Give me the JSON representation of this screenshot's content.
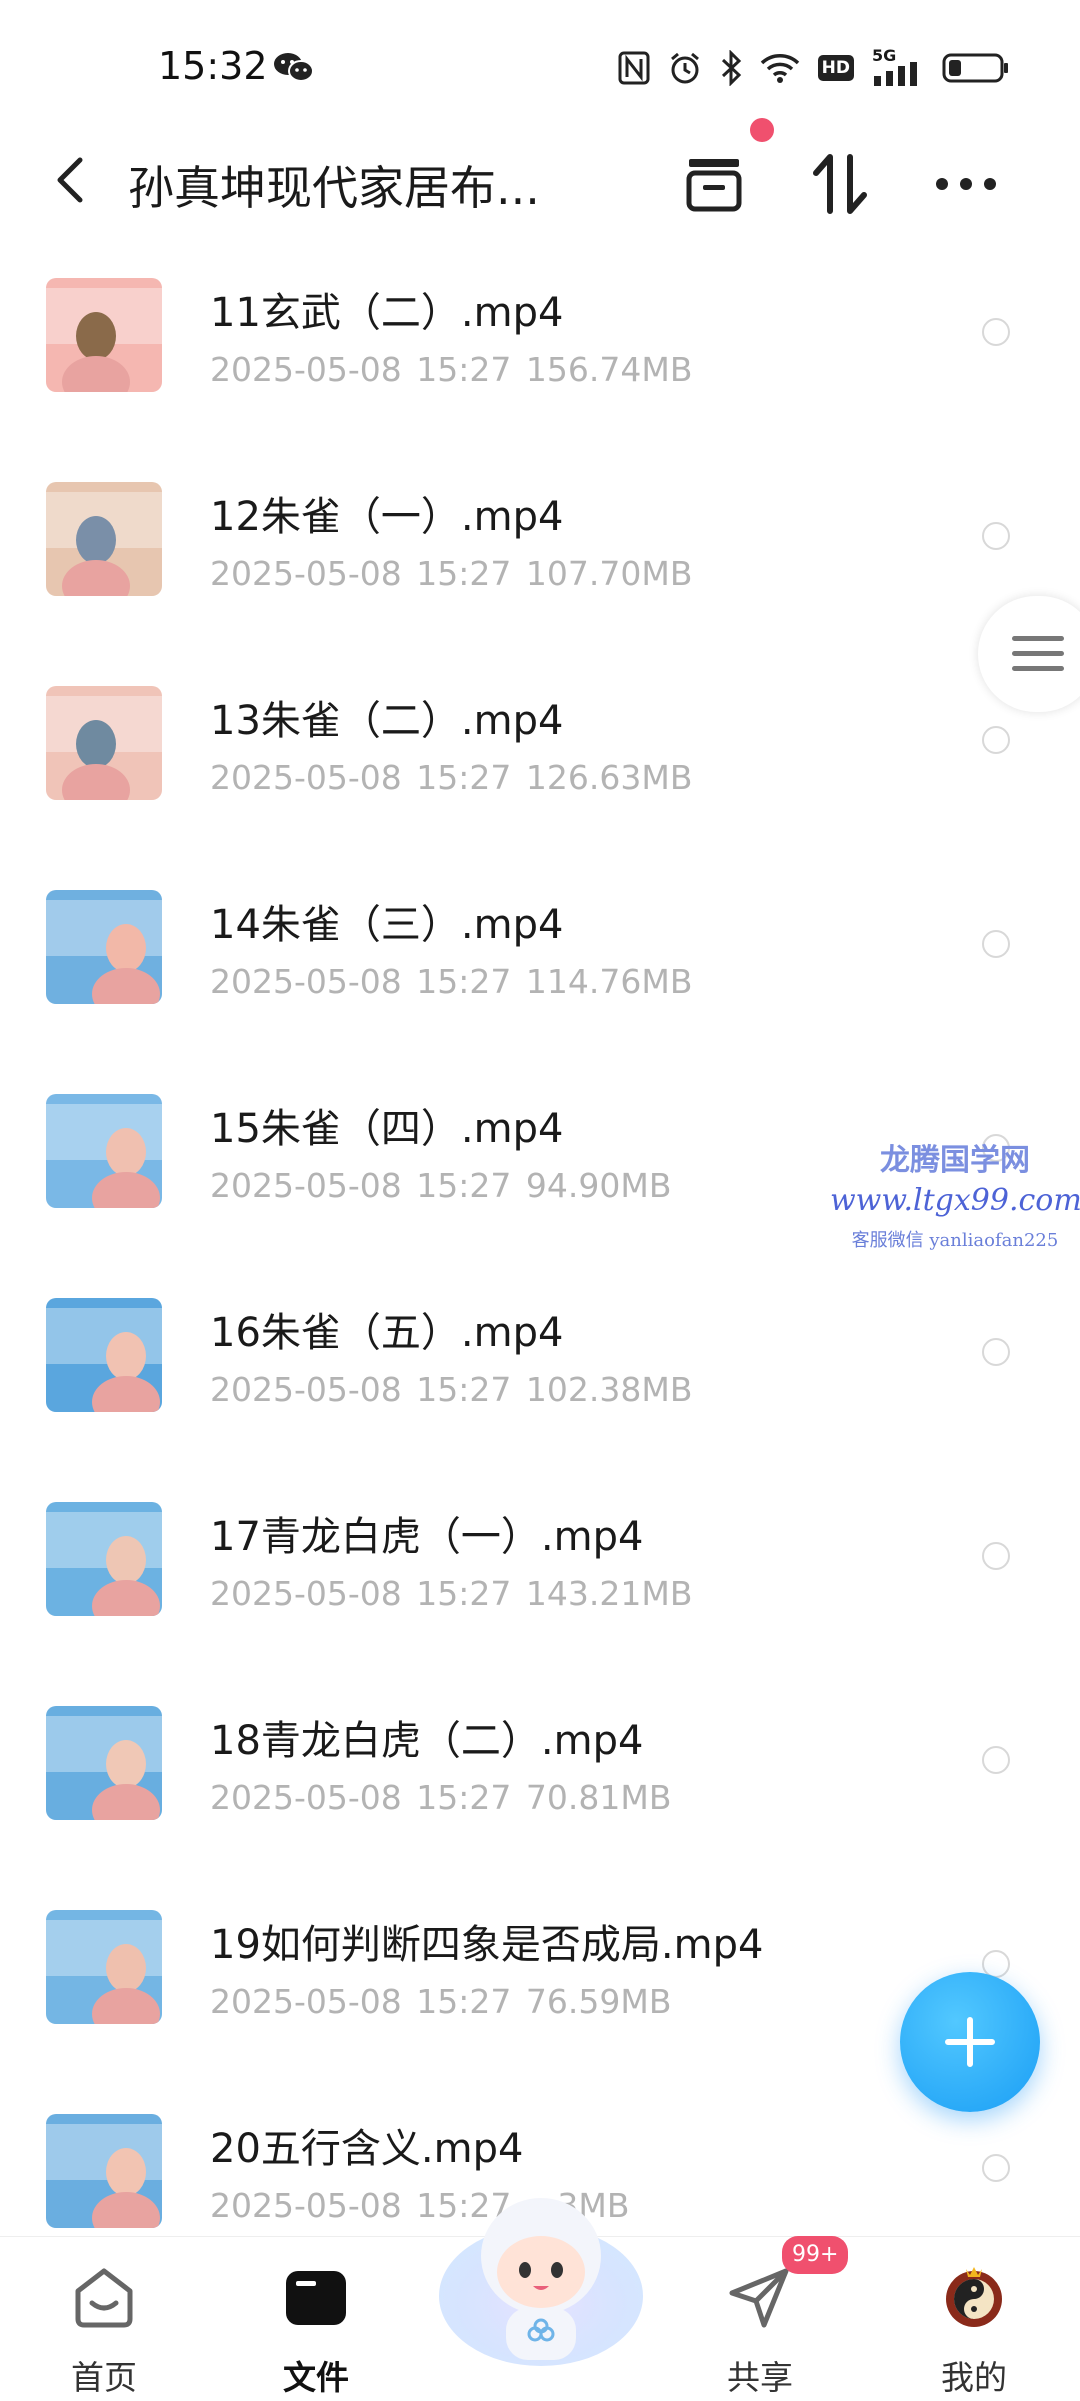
{
  "status_bar": {
    "time": "15:32",
    "network_label": "5G",
    "hd_label": "HD"
  },
  "header": {
    "title": "孙真坤现代家居布..."
  },
  "files": [
    {
      "name": "11玄武（二）.mp4",
      "date": "2025-05-08",
      "time": "15:27",
      "size": "156.74MB"
    },
    {
      "name": "12朱雀（一）.mp4",
      "date": "2025-05-08",
      "time": "15:27",
      "size": "107.70MB"
    },
    {
      "name": "13朱雀（二）.mp4",
      "date": "2025-05-08",
      "time": "15:27",
      "size": "126.63MB"
    },
    {
      "name": "14朱雀（三）.mp4",
      "date": "2025-05-08",
      "time": "15:27",
      "size": "114.76MB"
    },
    {
      "name": "15朱雀（四）.mp4",
      "date": "2025-05-08",
      "time": "15:27",
      "size": "94.90MB"
    },
    {
      "name": "16朱雀（五）.mp4",
      "date": "2025-05-08",
      "time": "15:27",
      "size": "102.38MB"
    },
    {
      "name": "17青龙白虎（一）.mp4",
      "date": "2025-05-08",
      "time": "15:27",
      "size": "143.21MB"
    },
    {
      "name": "18青龙白虎（二）.mp4",
      "date": "2025-05-08",
      "time": "15:27",
      "size": "70.81MB"
    },
    {
      "name": "19如何判断四象是否成局.mp4",
      "date": "2025-05-08",
      "time": "15:27",
      "size": "76.59MB"
    },
    {
      "name": "20五行含义.mp4",
      "date": "2025-05-08",
      "time": "15:27",
      "size": "...3MB"
    }
  ],
  "watermark": {
    "title": "龙腾国学网",
    "url": "www.ltgx99.com",
    "contact": "客服微信 yanliaofan225"
  },
  "bottom_nav": {
    "items": [
      {
        "label": "首页",
        "icon": "home-icon",
        "active": false
      },
      {
        "label": "文件",
        "icon": "folder-icon",
        "active": true
      },
      {
        "label": "共享",
        "icon": "send-icon",
        "active": false
      },
      {
        "label": "我的",
        "icon": "avatar-icon",
        "active": false
      }
    ],
    "share_badge": "99+"
  },
  "colors": {
    "accent": "#1a9ef5",
    "badge": "#f0506e",
    "meta_text": "#b3b3b3"
  }
}
